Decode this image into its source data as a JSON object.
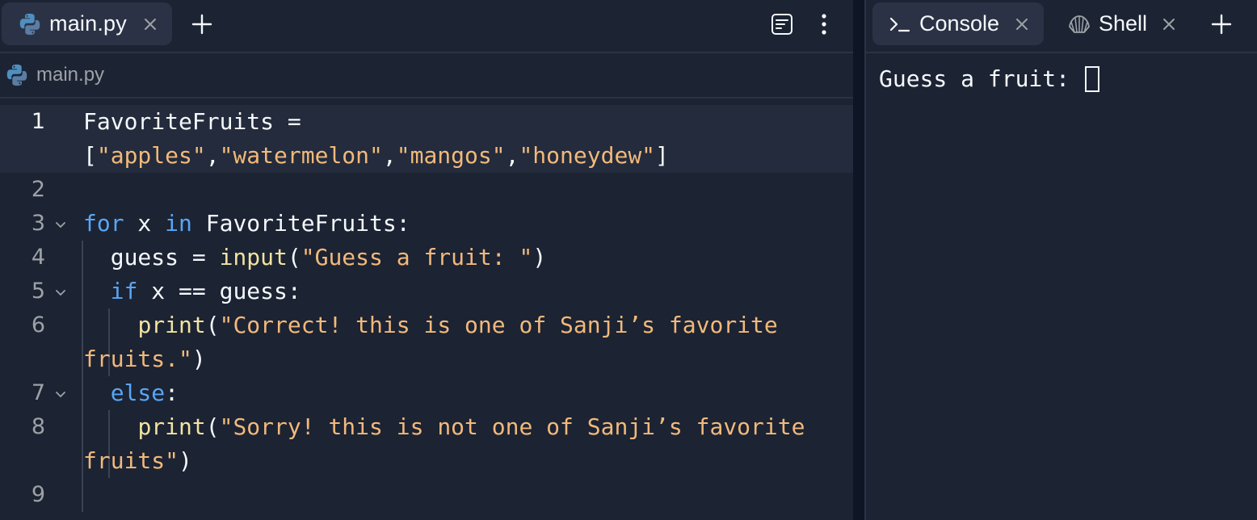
{
  "editor": {
    "tab": {
      "label": "main.py",
      "icon": "python-icon"
    },
    "breadcrumb": {
      "label": "main.py",
      "icon": "python-icon"
    },
    "lines": [
      {
        "num": "1",
        "tokens": [
          {
            "t": "FavoriteFruits =",
            "c": "plain"
          }
        ]
      },
      {
        "num": "",
        "tokens": [
          {
            "t": "[",
            "c": "plain"
          },
          {
            "t": "\"apples\"",
            "c": "str"
          },
          {
            "t": ",",
            "c": "plain"
          },
          {
            "t": "\"watermelon\"",
            "c": "str"
          },
          {
            "t": ",",
            "c": "plain"
          },
          {
            "t": "\"mangos\"",
            "c": "str"
          },
          {
            "t": ",",
            "c": "plain"
          },
          {
            "t": "\"honeydew\"",
            "c": "str"
          },
          {
            "t": "]",
            "c": "plain"
          }
        ]
      },
      {
        "num": "2",
        "tokens": []
      },
      {
        "num": "3",
        "tokens": [
          {
            "t": "for",
            "c": "kw"
          },
          {
            "t": " x ",
            "c": "plain"
          },
          {
            "t": "in",
            "c": "kw"
          },
          {
            "t": " FavoriteFruits:",
            "c": "plain"
          }
        ]
      },
      {
        "num": "4",
        "tokens": [
          {
            "t": "  guess = ",
            "c": "plain"
          },
          {
            "t": "input",
            "c": "fn"
          },
          {
            "t": "(",
            "c": "plain"
          },
          {
            "t": "\"Guess a fruit: \"",
            "c": "str"
          },
          {
            "t": ")",
            "c": "plain"
          }
        ]
      },
      {
        "num": "5",
        "tokens": [
          {
            "t": "  ",
            "c": "plain"
          },
          {
            "t": "if",
            "c": "kw"
          },
          {
            "t": " x == guess:",
            "c": "plain"
          }
        ]
      },
      {
        "num": "6",
        "tokens": [
          {
            "t": "    ",
            "c": "plain"
          },
          {
            "t": "print",
            "c": "fn"
          },
          {
            "t": "(",
            "c": "plain"
          },
          {
            "t": "\"Correct! this is one of Sanji’s favorite",
            "c": "str"
          }
        ]
      },
      {
        "num": "",
        "tokens": [
          {
            "t": "fruits.\"",
            "c": "str"
          },
          {
            "t": ")",
            "c": "plain"
          }
        ]
      },
      {
        "num": "7",
        "tokens": [
          {
            "t": "  ",
            "c": "plain"
          },
          {
            "t": "else",
            "c": "kw"
          },
          {
            "t": ":",
            "c": "plain"
          }
        ]
      },
      {
        "num": "8",
        "tokens": [
          {
            "t": "    ",
            "c": "plain"
          },
          {
            "t": "print",
            "c": "fn"
          },
          {
            "t": "(",
            "c": "plain"
          },
          {
            "t": "\"Sorry! this is not one of Sanji’s favorite",
            "c": "str"
          }
        ]
      },
      {
        "num": "",
        "tokens": [
          {
            "t": "fruits\"",
            "c": "str"
          },
          {
            "t": ")",
            "c": "plain"
          }
        ]
      },
      {
        "num": "9",
        "tokens": []
      }
    ]
  },
  "console": {
    "tabs": [
      {
        "label": "Console",
        "icon": "terminal-prompt-icon"
      },
      {
        "label": "Shell",
        "icon": "shell-icon"
      }
    ],
    "output": "Guess a fruit: "
  },
  "colors": {
    "background": "#1c2333",
    "keyword": "#58a6f5",
    "function": "#f2e3a0",
    "string": "#f2b97a",
    "text": "#f5f9fc",
    "line_number": "#9da2a6"
  }
}
